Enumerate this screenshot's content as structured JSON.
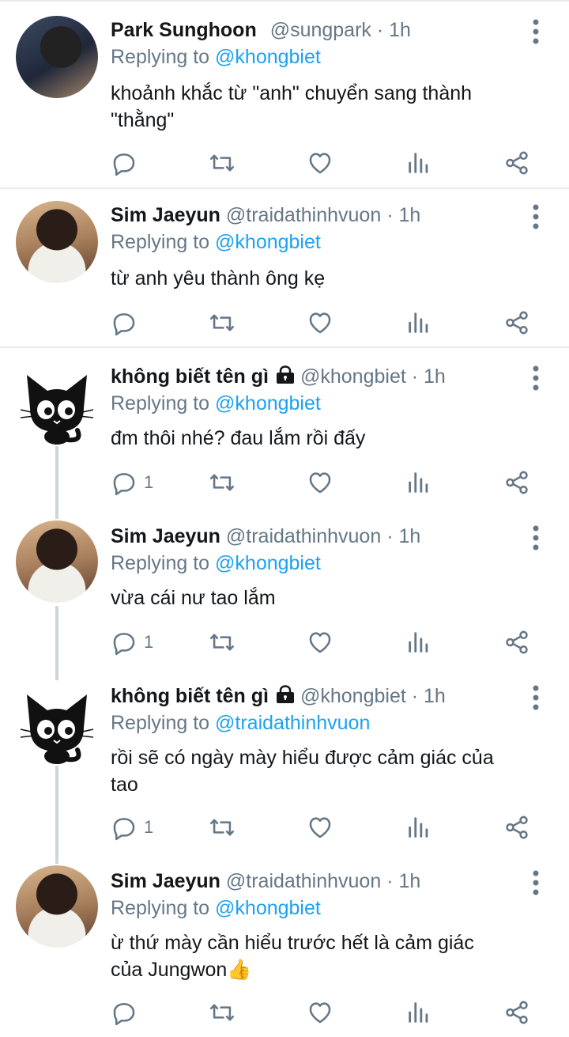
{
  "tweets": [
    {
      "name": "Park Sunghoon",
      "handle": "@sungpark",
      "time": "1h",
      "reply_label": "Replying to",
      "reply_to": "@khongbiet",
      "text_lines": [
        "khoảnh khắc từ \"anh\" chuyển sang thành",
        "\"thằng\""
      ],
      "reply_count": "",
      "locked": false,
      "avatar": "photo-avatar"
    },
    {
      "name": "Sim Jaeyun",
      "handle": "@traidathinhvuon",
      "time": "1h",
      "reply_label": "Replying to",
      "reply_to": "@khongbiet",
      "text_lines": [
        "từ anh yêu thành ông kẹ"
      ],
      "reply_count": "",
      "locked": false,
      "avatar": "photo-avatar"
    },
    {
      "name": "không biết tên gì",
      "handle": "@khongbiet",
      "time": "1h",
      "reply_label": "Replying to",
      "reply_to": "@khongbiet",
      "text_lines": [
        "đm thôi nhé? đau lắm rồi đấy"
      ],
      "reply_count": "1",
      "locked": true,
      "avatar": "black-cat-avatar"
    },
    {
      "name": "Sim Jaeyun",
      "handle": "@traidathinhvuon",
      "time": "1h",
      "reply_label": "Replying to",
      "reply_to": "@khongbiet",
      "text_lines": [
        "vừa cái nư tao lắm"
      ],
      "reply_count": "1",
      "locked": false,
      "avatar": "photo-avatar"
    },
    {
      "name": "không biết tên gì",
      "handle": "@khongbiet",
      "time": "1h",
      "reply_label": "Replying to",
      "reply_to": "@traidathinhvuon",
      "text_lines": [
        "rồi sẽ có ngày mày hiểu được cảm giác của",
        "tao"
      ],
      "reply_count": "1",
      "locked": true,
      "avatar": "black-cat-avatar"
    },
    {
      "name": "Sim Jaeyun",
      "handle": "@traidathinhvuon",
      "time": "1h",
      "reply_label": "Replying to",
      "reply_to": "@khongbiet",
      "text_lines": [
        "ừ thứ mày cần hiểu trước hết là cảm giác",
        "của Jungwon👍"
      ],
      "reply_count": "",
      "locked": false,
      "avatar": "photo-avatar"
    }
  ],
  "separator": " · ",
  "colors": {
    "link": "#1da1f2",
    "secondary": "#657786",
    "text": "#14171a",
    "divider": "#e6ecf0",
    "thread_line": "#ccd6dd"
  },
  "icons": {
    "reply": "reply-icon",
    "retweet": "retweet-icon",
    "like": "heart-icon",
    "analytics": "analytics-icon",
    "share": "share-icon",
    "more": "more-vertical-icon",
    "lock": "lock-icon"
  }
}
